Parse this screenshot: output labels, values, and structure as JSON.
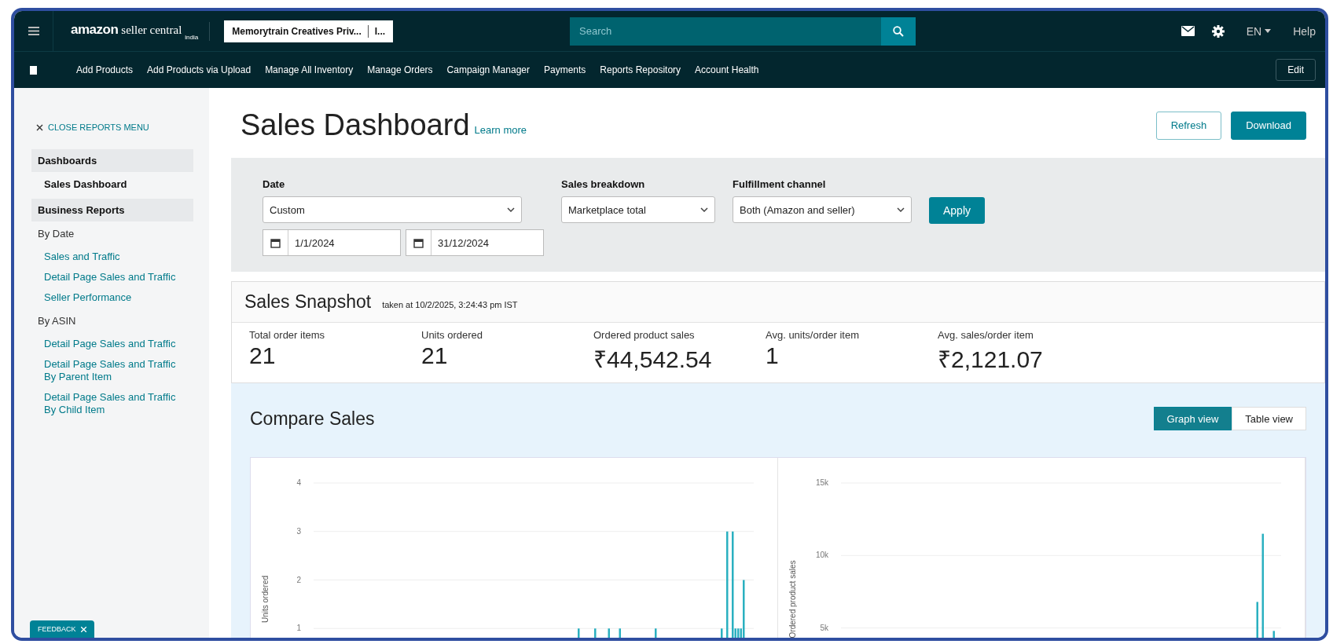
{
  "header": {
    "logo": {
      "brand": "amazon",
      "product": "seller central",
      "region": "india"
    },
    "account": {
      "name": "Memorytrain Creatives Priv...",
      "marketplace": "I..."
    },
    "search": {
      "placeholder": "Search"
    },
    "language": "EN",
    "help": "Help"
  },
  "nav": {
    "items": [
      "Add Products",
      "Add Products via Upload",
      "Manage All Inventory",
      "Manage Orders",
      "Campaign Manager",
      "Payments",
      "Reports Repository",
      "Account Health"
    ],
    "edit": "Edit"
  },
  "sidebar": {
    "close_label": "CLOSE REPORTS MENU",
    "sections": [
      {
        "title": "Dashboards",
        "groups": [
          {
            "items": [
              {
                "label": "Sales Dashboard",
                "selected": true
              }
            ]
          }
        ]
      },
      {
        "title": "Business Reports",
        "groups": [
          {
            "title": "By Date",
            "items": [
              {
                "label": "Sales and Traffic",
                "selected": false
              },
              {
                "label": "Detail Page Sales and Traffic",
                "selected": false
              },
              {
                "label": "Seller Performance",
                "selected": false
              }
            ]
          },
          {
            "title": "By ASIN",
            "items": [
              {
                "label": "Detail Page Sales and Traffic",
                "selected": false
              },
              {
                "label": "Detail Page Sales and Traffic By Parent Item",
                "selected": false
              },
              {
                "label": "Detail Page Sales and Traffic By Child Item",
                "selected": false
              }
            ]
          }
        ]
      }
    ],
    "feedback": "FEEDBACK"
  },
  "page": {
    "title": "Sales Dashboard",
    "learn_more": "Learn more",
    "buttons": [
      {
        "label": "Refresh",
        "kind": "secondary"
      },
      {
        "label": "Download",
        "kind": "primary"
      }
    ]
  },
  "filters": {
    "date": {
      "label": "Date",
      "value": "Custom",
      "from": "1/1/2024",
      "to": "31/12/2024"
    },
    "sales_breakdown": {
      "label": "Sales breakdown",
      "value": "Marketplace total"
    },
    "fulfillment_channel": {
      "label": "Fulfillment channel",
      "value": "Both (Amazon and seller)"
    },
    "apply": "Apply"
  },
  "snapshot": {
    "title": "Sales Snapshot",
    "taken_at": "taken at 10/2/2025, 3:24:43 pm IST",
    "metrics": [
      {
        "label": "Total order items",
        "value": "21"
      },
      {
        "label": "Units ordered",
        "value": "21"
      },
      {
        "label": "Ordered product sales",
        "value": "₹44,542.54"
      },
      {
        "label": "Avg. units/order item",
        "value": "1"
      },
      {
        "label": "Avg. sales/order item",
        "value": "₹2,121.07"
      }
    ]
  },
  "compare": {
    "title": "Compare Sales",
    "views": [
      {
        "label": "Graph view",
        "selected": true
      },
      {
        "label": "Table view",
        "selected": false
      }
    ],
    "charts": [
      {
        "chart_data": {
          "type": "bar",
          "ylabel": "Units ordered",
          "grid": true,
          "ylim": [
            0,
            4
          ],
          "yticks": [
            1,
            2,
            3,
            4
          ],
          "categories": [
            null,
            null,
            null,
            null,
            null,
            null,
            null,
            null,
            null,
            null,
            null,
            null,
            null,
            null,
            null,
            null,
            null,
            null,
            null,
            null,
            null,
            null,
            null,
            null,
            null,
            null,
            null,
            null,
            null,
            null,
            null,
            null,
            null,
            null,
            null,
            null,
            null,
            null,
            null,
            null,
            null,
            null,
            null,
            null,
            null,
            null,
            null,
            null,
            null,
            null,
            null,
            null,
            null,
            null,
            null,
            null,
            null,
            null,
            null,
            null,
            null,
            null,
            null,
            null,
            null,
            null,
            null,
            null,
            null,
            null,
            null,
            null,
            null,
            null,
            null,
            null,
            null,
            null,
            null,
            null,
            null,
            null,
            null,
            null,
            null,
            null,
            null,
            null,
            null,
            null,
            null,
            null,
            null,
            null,
            null,
            null,
            null,
            null,
            null,
            null,
            null,
            null,
            null,
            null,
            null,
            null,
            null,
            null,
            null,
            null,
            null,
            null,
            null,
            null,
            null,
            null,
            null,
            null,
            null,
            null,
            null,
            null,
            null,
            null,
            null,
            null,
            null,
            null,
            null,
            null,
            null,
            null,
            null,
            null,
            null,
            null,
            null,
            null,
            null,
            null,
            null,
            null,
            null,
            null,
            null,
            null,
            null,
            null,
            null,
            null,
            null,
            null,
            null,
            null,
            null,
            null,
            null,
            null,
            null,
            null
          ],
          "series": [
            {
              "color": "#2ab0c0",
              "values": [
                0,
                0,
                0,
                0,
                0,
                0,
                0,
                0,
                0,
                0,
                0,
                0,
                0,
                0,
                0,
                0,
                0,
                0,
                0,
                0,
                0,
                0,
                0,
                0,
                0,
                0,
                0,
                0,
                0,
                0,
                0,
                0,
                0,
                0,
                0,
                0,
                0,
                0,
                0,
                0,
                0,
                0,
                0,
                0,
                0,
                0,
                0,
                0,
                0,
                0,
                0,
                0,
                0,
                0,
                0,
                0,
                0,
                0,
                0,
                0,
                0,
                0,
                0,
                0,
                0,
                0,
                0,
                0,
                0,
                0,
                0,
                0,
                0,
                0,
                0,
                0,
                0,
                0,
                0,
                0,
                0,
                0,
                0,
                0,
                0,
                0,
                0,
                0,
                0,
                0,
                0,
                0,
                0,
                0,
                0,
                0,
                1,
                0,
                0,
                0,
                0,
                0,
                1,
                0,
                0,
                0,
                0,
                1,
                0,
                0,
                0,
                1,
                0,
                0,
                0,
                0,
                0,
                0,
                0,
                0,
                0,
                0,
                0,
                0,
                1,
                0,
                0,
                0,
                0,
                0,
                0,
                0,
                0,
                0,
                0,
                0,
                0,
                0,
                0,
                0,
                0,
                0,
                0,
                0,
                0,
                0,
                0,
                0,
                1,
                0,
                3,
                0,
                3,
                1,
                1,
                1,
                2,
                0,
                0,
                0
              ]
            }
          ]
        }
      },
      {
        "chart_data": {
          "type": "bar",
          "ylabel": "Ordered product sales",
          "grid": true,
          "ylim": [
            0,
            15000
          ],
          "yticks": [
            {
              "value": 5000,
              "label": "5k"
            },
            {
              "value": 10000,
              "label": "10k"
            },
            {
              "value": 15000,
              "label": "15k"
            }
          ],
          "categories": [
            null,
            null,
            null,
            null,
            null,
            null,
            null,
            null,
            null,
            null,
            null,
            null,
            null,
            null,
            null,
            null,
            null,
            null,
            null,
            null,
            null,
            null,
            null,
            null,
            null,
            null,
            null,
            null,
            null,
            null,
            null,
            null,
            null,
            null,
            null,
            null,
            null,
            null,
            null,
            null,
            null,
            null,
            null,
            null,
            null,
            null,
            null,
            null,
            null,
            null,
            null,
            null,
            null,
            null,
            null,
            null,
            null,
            null,
            null,
            null,
            null,
            null,
            null,
            null,
            null,
            null,
            null,
            null,
            null,
            null,
            null,
            null,
            null,
            null,
            null,
            null,
            null,
            null,
            null,
            null,
            null,
            null,
            null,
            null,
            null,
            null,
            null,
            null,
            null,
            null,
            null,
            null,
            null,
            null,
            null,
            null,
            null,
            null,
            null,
            null,
            null,
            null,
            null,
            null,
            null,
            null,
            null,
            null,
            null,
            null,
            null,
            null,
            null,
            null,
            null,
            null,
            null,
            null,
            null,
            null,
            null,
            null,
            null,
            null,
            null,
            null,
            null,
            null,
            null,
            null,
            null,
            null,
            null,
            null,
            null,
            null,
            null,
            null,
            null,
            null,
            null,
            null,
            null,
            null,
            null,
            null,
            null,
            null,
            null,
            null,
            null,
            null,
            null,
            null,
            null,
            null,
            null,
            null,
            null,
            null
          ],
          "series": [
            {
              "color": "#2ab0c0",
              "values": [
                0,
                0,
                0,
                0,
                0,
                0,
                0,
                0,
                0,
                0,
                0,
                0,
                0,
                0,
                0,
                0,
                0,
                0,
                0,
                0,
                0,
                0,
                0,
                0,
                0,
                0,
                0,
                0,
                0,
                0,
                0,
                0,
                0,
                0,
                0,
                0,
                0,
                0,
                0,
                0,
                0,
                0,
                0,
                0,
                0,
                0,
                0,
                0,
                0,
                0,
                0,
                0,
                0,
                0,
                0,
                0,
                0,
                0,
                0,
                0,
                0,
                0,
                0,
                0,
                0,
                0,
                0,
                0,
                0,
                0,
                0,
                0,
                0,
                0,
                0,
                0,
                0,
                0,
                0,
                0,
                0,
                0,
                0,
                0,
                0,
                0,
                0,
                0,
                0,
                0,
                0,
                0,
                0,
                0,
                0,
                0,
                0,
                0,
                0,
                0,
                0,
                0,
                0,
                0,
                0,
                0,
                0,
                0,
                0,
                0,
                0,
                0,
                0,
                0,
                0,
                0,
                0,
                0,
                0,
                0,
                0,
                0,
                0,
                0,
                0,
                0,
                0,
                0,
                0,
                0,
                0,
                0,
                0,
                0,
                0,
                0,
                0,
                0,
                0,
                0,
                0,
                0,
                0,
                0,
                0,
                0,
                0,
                0,
                0,
                0,
                0,
                6800,
                0,
                11500,
                0,
                0,
                0,
                4800,
                0,
                0
              ]
            }
          ]
        }
      }
    ]
  }
}
